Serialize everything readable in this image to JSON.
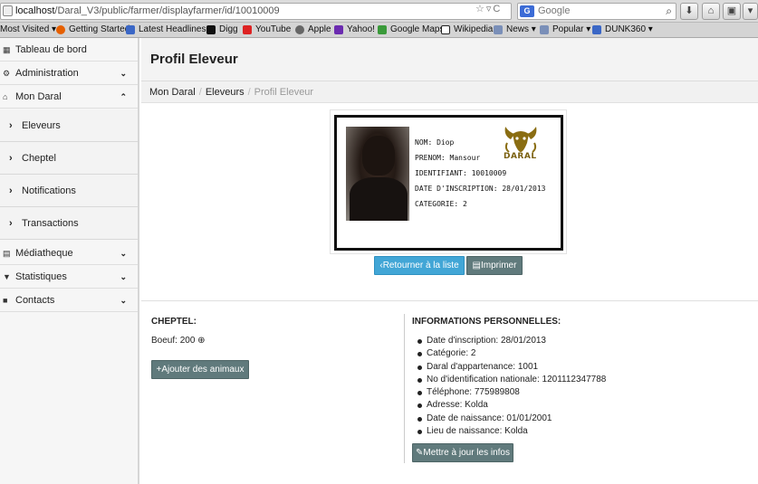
{
  "browser": {
    "url_host": "localhost",
    "url_path": "/Daral_V3/public/farmer/displayfarmer/id/10010009",
    "search_placeholder": "Google",
    "search_engine_letter": "G",
    "bookmarks": [
      {
        "label": "Most Visited ▾",
        "icon": "none"
      },
      {
        "label": "Getting Started",
        "icon": "firefox-icon",
        "color": "#e66000"
      },
      {
        "label": "Latest Headlines ▾",
        "icon": "rss-icon",
        "color": "#3b67c6"
      },
      {
        "label": "Digg",
        "icon": "digg-icon",
        "color": "#111111"
      },
      {
        "label": "YouTube",
        "icon": "youtube-icon",
        "color": "#d22"
      },
      {
        "label": "Apple",
        "icon": "apple-icon",
        "color": "#666666"
      },
      {
        "label": "Yahoo!",
        "icon": "yahoo-icon",
        "color": "#6b2bb0"
      },
      {
        "label": "Google Maps",
        "icon": "maps-icon",
        "color": "#3a9a3a"
      },
      {
        "label": "Wikipedia",
        "icon": "wikipedia-icon",
        "color": "#222222"
      },
      {
        "label": "News ▾",
        "icon": "folder-icon",
        "color": "#7a8fb8"
      },
      {
        "label": "Popular ▾",
        "icon": "folder-icon",
        "color": "#7a8fb8"
      },
      {
        "label": "DUNK360 ▾",
        "icon": "dunk-icon",
        "color": "#3b67c6"
      }
    ]
  },
  "sidebar": {
    "items": [
      {
        "label": "Tableau de bord",
        "icon": "grid-icon",
        "chevron": ""
      },
      {
        "label": "Administration",
        "icon": "gear-icon",
        "chevron": "⌄"
      },
      {
        "label": "Mon Daral",
        "icon": "home-icon",
        "chevron": "⌃"
      },
      {
        "label": "Médiatheque",
        "icon": "film-icon",
        "chevron": "⌄"
      },
      {
        "label": "Statistiques",
        "icon": "filter-icon",
        "chevron": "⌄"
      },
      {
        "label": "Contacts",
        "icon": "book-icon",
        "chevron": "⌄"
      }
    ],
    "subitems": [
      "Eleveurs",
      "Cheptel",
      "Notifications",
      "Transactions"
    ]
  },
  "page": {
    "title": "Profil Eleveur",
    "breadcrumb": [
      "Mon Daral",
      "Eleveurs",
      "Profil Eleveur"
    ]
  },
  "card": {
    "nom": "NOM: Diop",
    "prenom": "PRENOM: Mansour",
    "identifiant": "IDENTIFIANT: 10010009",
    "date_inscription": "DATE D'INSCRIPTION: 28/01/2013",
    "categorie": "CATEGORIE: 2",
    "logo_text": "DARAL"
  },
  "actions": {
    "back_label": "Retourner à la liste",
    "print_label": "Imprimer"
  },
  "cheptel": {
    "title": "CHEPTEL:",
    "line": "Boeuf: 200",
    "add_label": "Ajouter des animaux"
  },
  "infos": {
    "title": "INFORMATIONS PERSONNELLES:",
    "items": [
      "Date d'inscription: 28/01/2013",
      "Catégorie: 2",
      "Daral d'appartenance: 1001",
      "No d'identification nationale: 1201112347788",
      "Téléphone: 775989808",
      "Adresse: Kolda",
      "Date de naissance: 01/01/2001",
      "Lieu de naissance: Kolda"
    ],
    "update_label": "Mettre à jour les infos"
  },
  "colors": {
    "accent_info": "#42a6d6",
    "accent_gray": "#607a7c",
    "logo_gold": "#8a6d12"
  }
}
